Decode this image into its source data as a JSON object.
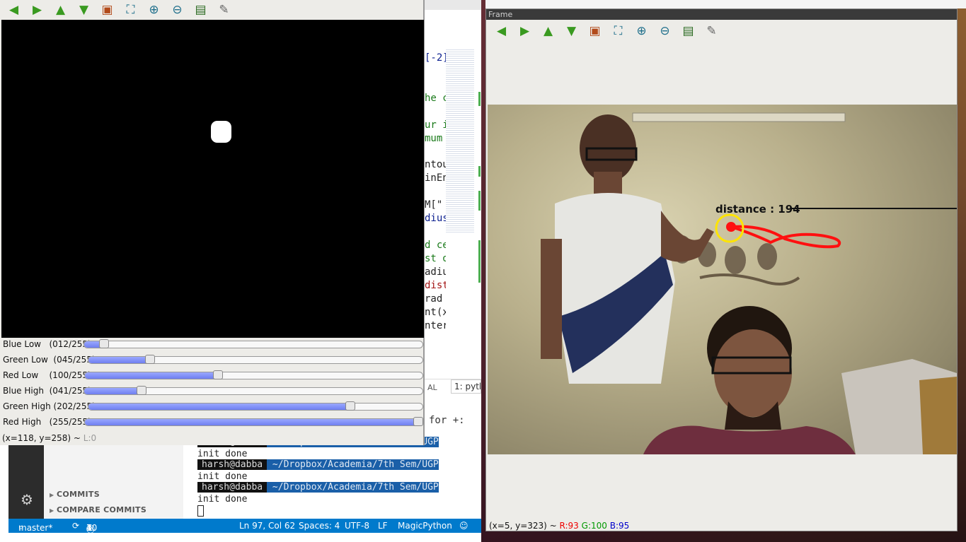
{
  "mask_window": {
    "toolbar": [
      {
        "name": "pan-left-icon",
        "glyph": "◀",
        "color": "#3a9a20"
      },
      {
        "name": "pan-right-icon",
        "glyph": "▶",
        "color": "#3a9a20"
      },
      {
        "name": "pan-up-icon",
        "glyph": "▲",
        "color": "#3a9a20"
      },
      {
        "name": "pan-down-icon",
        "glyph": "▼",
        "color": "#3a9a20"
      },
      {
        "name": "zoom-fit-icon",
        "glyph": "▣",
        "color": "#b24a1a"
      },
      {
        "name": "zoom-region-icon",
        "glyph": "⛶",
        "color": "#1f6f8b"
      },
      {
        "name": "zoom-in-icon",
        "glyph": "⊕",
        "color": "#1f6f8b"
      },
      {
        "name": "zoom-out-icon",
        "glyph": "⊖",
        "color": "#1f6f8b"
      },
      {
        "name": "save-icon",
        "glyph": "▤",
        "color": "#2a6a20"
      },
      {
        "name": "properties-icon",
        "glyph": "✎",
        "color": "#666666"
      }
    ],
    "sliders": [
      {
        "name": "blue-low",
        "label": "Blue Low   (012/255)",
        "value": 12
      },
      {
        "name": "green-low",
        "label": "Green Low  (045/255)",
        "value": 45
      },
      {
        "name": "red-low",
        "label": "Red Low    (100/255)",
        "value": 100
      },
      {
        "name": "blue-high",
        "label": "Blue High  (041/255)",
        "value": 41
      },
      {
        "name": "green-high",
        "label": "Green High (202/255)",
        "value": 202
      },
      {
        "name": "red-high",
        "label": "Red High   (255/255)",
        "value": 255
      }
    ],
    "slider_max": 255,
    "status_coords": "(x=118, y=258) ~ ",
    "status_level": "L:0"
  },
  "frame_window": {
    "title": "Frame",
    "overlay_text": "distance : 194",
    "status": {
      "coords": "(x=5, y=323) ~ ",
      "r": "R:93",
      "g": "G:100",
      "b": "B:95"
    }
  },
  "vscode": {
    "sidebar_items": [
      "COMMITS",
      "COMPARE COMMITS"
    ],
    "terminal_tab": "AL",
    "terminal_select": "1: pyth",
    "terminal_for": "for +:",
    "terminal_lines": [
      {
        "type": "prompt",
        "user": "harsh@dabba",
        "path": " ~/Dropbox/Academia/7th Sem/UGP"
      },
      {
        "type": "text",
        "text": "init done"
      },
      {
        "type": "prompt",
        "user": "harsh@dabba",
        "path": " ~/Dropbox/Academia/7th Sem/UGP"
      },
      {
        "type": "text",
        "text": "init done"
      },
      {
        "type": "prompt",
        "user": "harsh@dabba",
        "path": " ~/Dropbox/Academia/7th Sem/UGP"
      },
      {
        "type": "text",
        "text": "init done"
      }
    ],
    "code_fragments": [
      {
        "text": "[-2]",
        "color": "#0b1f8f"
      },
      {
        "text": "he c",
        "color": "#1a7a1a"
      },
      {
        "text": "ur i",
        "color": "#1a7a1a"
      },
      {
        "text": "mum ",
        "color": "#1a7a1a"
      },
      {
        "text": "ntou",
        "color": "#222222"
      },
      {
        "text": "inEn",
        "color": "#222222"
      },
      {
        "text": " M[\"",
        "color": "#222222"
      },
      {
        "text": "dius",
        "color": "#0b1f8f"
      },
      {
        "text": "d ce",
        "color": "#1a7a1a"
      },
      {
        "text": "st o",
        "color": "#1a7a1a"
      },
      {
        "text": "adiu",
        "color": "#222222"
      },
      {
        "text": "dist",
        "color": "#a31515"
      },
      {
        "text": " rad",
        "color": "#222222"
      },
      {
        "text": "nt(x",
        "color": "#222222"
      },
      {
        "text": "nter",
        "color": "#222222"
      }
    ],
    "status": {
      "branch": "master*",
      "errors": "1",
      "warnings": "7",
      "info": "40",
      "position": "Ln 97, Col 62",
      "spaces": "Spaces: 4",
      "encoding": "UTF-8",
      "eol": "LF",
      "language": "MagicPython"
    }
  }
}
